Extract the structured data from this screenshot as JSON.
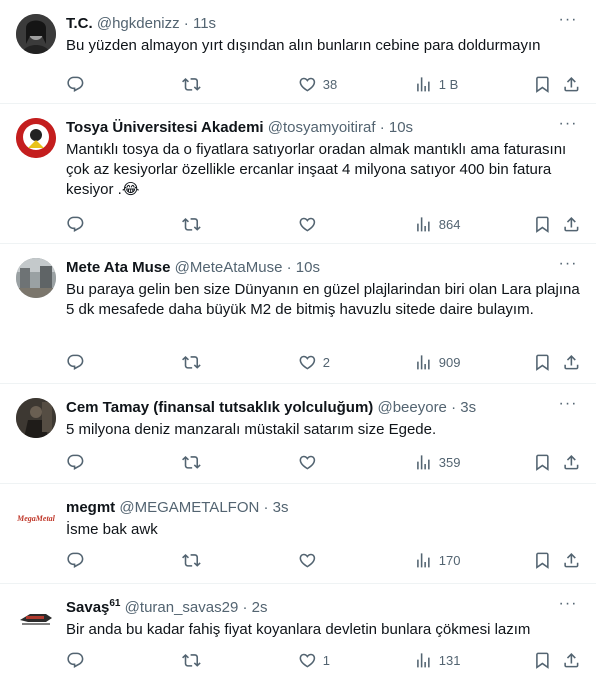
{
  "tweets": [
    {
      "name": "T.C.",
      "name_sup": "",
      "handle": "@hgkdenizz",
      "time": "11s",
      "text": "Bu yüzden almayon yırt dışından alın bunların cebine para doldurmayın",
      "replies": "",
      "retweets": "",
      "likes": "38",
      "views": "1 B",
      "colors": {
        "avatar_bg": "#2b2b2b"
      }
    },
    {
      "name": "Tosya Üniversitesi Akademi",
      "name_sup": "",
      "handle": "@tosyamyoitiraf",
      "time": "10s",
      "text": "Mantıklı tosya da o fiyatlara satıyorlar oradan almak mantıklı ama faturasını çok az kesiyorlar özellikle ercanlar inşaat 4 milyona satıyor 400 bin fatura kesiyor .😂",
      "replies": "",
      "retweets": "",
      "likes": "",
      "views": "864",
      "colors": {
        "avatar_bg": "#c41e1e"
      }
    },
    {
      "name": "Mete Ata Muse",
      "name_sup": "",
      "handle": "@MeteAtaMuse",
      "time": "10s",
      "text": "Bu paraya gelin ben size Dünyanın en güzel plajlarindan biri olan Lara plajına 5 dk mesafede daha büyük M2 de bitmiş havuzlu sitede daire bulayım.",
      "replies": "",
      "retweets": "",
      "likes": "2",
      "views": "909",
      "colors": {
        "avatar_bg": "#8a8f91"
      }
    },
    {
      "name": "Cem Tamay (finansal tutsaklık yolculuğum)",
      "name_sup": "",
      "handle": "@beeyore",
      "time": "3s",
      "text": "5 milyona deniz manzaralı müstakil satarım size Egede.",
      "replies": "",
      "retweets": "",
      "likes": "",
      "views": "359",
      "colors": {
        "avatar_bg": "#3a3631"
      }
    },
    {
      "name": "megmt",
      "name_sup": "",
      "handle": "@MEGAMETALFON",
      "time": "3s",
      "text": "İsme bak awk",
      "replies": "",
      "retweets": "",
      "likes": "",
      "views": "170",
      "avatar_logo": "MegaMetal",
      "colors": {
        "avatar_bg": "#ffffff",
        "logo_text": "#c0392b"
      }
    },
    {
      "name": "Savaş",
      "name_sup": "61",
      "handle": "@turan_savas29",
      "time": "2s",
      "text": "Bir anda bu kadar fahiş fiyat koyanlara devletin bunlara çökmesi lazım",
      "replies": "",
      "retweets": "",
      "likes": "1",
      "views": "131",
      "colors": {
        "avatar_bg": "#ffffff"
      }
    }
  ],
  "separator_dot": "·",
  "icons": [
    "reply-icon",
    "retweet-icon",
    "like-icon",
    "views-icon",
    "bookmark-icon",
    "share-icon",
    "more-icon"
  ]
}
